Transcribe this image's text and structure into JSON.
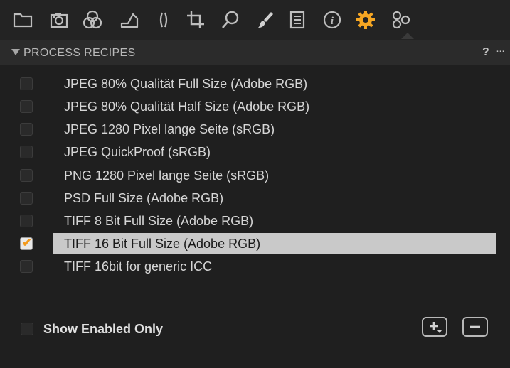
{
  "toolbar": {
    "tools": [
      {
        "icon": "library-folder-icon"
      },
      {
        "icon": "camera-capture-icon"
      },
      {
        "icon": "color-circles-icon"
      },
      {
        "icon": "exposure-icon"
      },
      {
        "icon": "lens-icon"
      },
      {
        "icon": "crop-icon"
      },
      {
        "icon": "details-loupe-icon"
      },
      {
        "icon": "brush-icon"
      },
      {
        "icon": "metadata-list-icon"
      },
      {
        "icon": "info-icon"
      },
      {
        "icon": "output-gear-icon",
        "active": true,
        "color": "#f5a623"
      },
      {
        "icon": "adjustments-gears-icon"
      }
    ]
  },
  "panel": {
    "title": "PROCESS RECIPES",
    "help": "?",
    "more": "···"
  },
  "recipes": [
    {
      "label": "JPEG 80% Qualität Full Size (Adobe RGB)",
      "checked": false,
      "selected": false
    },
    {
      "label": "JPEG 80% Qualität Half Size (Adobe RGB)",
      "checked": false,
      "selected": false
    },
    {
      "label": "JPEG 1280 Pixel lange Seite (sRGB)",
      "checked": false,
      "selected": false
    },
    {
      "label": "JPEG QuickProof (sRGB)",
      "checked": false,
      "selected": false
    },
    {
      "label": "PNG 1280 Pixel lange Seite (sRGB)",
      "checked": false,
      "selected": false
    },
    {
      "label": "PSD Full Size (Adobe RGB)",
      "checked": false,
      "selected": false
    },
    {
      "label": "TIFF 8 Bit Full Size (Adobe RGB)",
      "checked": false,
      "selected": false
    },
    {
      "label": "TIFF 16 Bit Full Size (Adobe RGB)",
      "checked": true,
      "selected": true
    },
    {
      "label": "TIFF 16bit for generic ICC",
      "checked": false,
      "selected": false
    }
  ],
  "footer": {
    "show_enabled_only": "Show Enabled Only",
    "show_enabled_checked": false
  },
  "colors": {
    "accent": "#f5a623",
    "selection": "#c9c9c9"
  }
}
